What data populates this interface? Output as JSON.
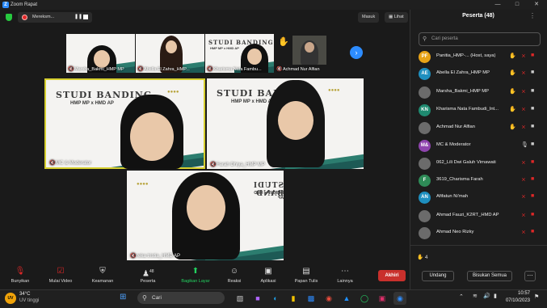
{
  "window": {
    "title": "Zoom Rapat",
    "logo": "Z"
  },
  "topbar": {
    "share_label": "Mereksm...",
    "view_btn": "Masuk",
    "view2_btn": "Lihat"
  },
  "thumbnails": [
    {
      "name": "Marsha_Bakmi_HMP MP"
    },
    {
      "name": "Abella El Zahra_HMP..."
    },
    {
      "name": "Kharisma Nata Fambu..."
    },
    {
      "name": "Achmad Nur Alfian"
    }
  ],
  "slide": {
    "title": "STUDI BANDING",
    "subtitle": "HMP MP x HMD AP",
    "title_small": "STUDI BANDING",
    "subtitle_small": "HMP MP x HMD AP",
    "mirror_title": "STUDI BAND",
    "mirror_sub": "HMP MP x HMD AP"
  },
  "tiles": [
    {
      "name": "MC & Moderator"
    },
    {
      "name": "Farah Dhiya_HMP MP"
    },
    {
      "name": "reka tristia_HMD AP"
    }
  ],
  "toolbar": {
    "items": [
      {
        "label": "Bunyikan",
        "icon": "mic-muted-icon"
      },
      {
        "label": "Mulai Video",
        "icon": "video-off-icon"
      },
      {
        "label": "Keamanan",
        "icon": "shield-icon"
      },
      {
        "label": "Peserta",
        "count": "48",
        "icon": "participants-icon"
      },
      {
        "label": "Bagikan Layar",
        "icon": "share-screen-icon"
      },
      {
        "label": "Reaksi",
        "icon": "reaction-icon"
      },
      {
        "label": "Aplikasi",
        "icon": "apps-icon"
      },
      {
        "label": "Papan Tulis",
        "icon": "whiteboard-icon"
      },
      {
        "label": "Lainnya",
        "icon": "more-icon"
      }
    ],
    "end_label": "Akhiri"
  },
  "panel": {
    "title": "Peserta (48)",
    "search_placeholder": "Cari peserta",
    "participants": [
      {
        "initials": "PF",
        "color": "#e8a317",
        "name": "Panitia_HMP-...",
        "note": "(Host, saya)"
      },
      {
        "initials": "AE",
        "color": "#1e8fbf",
        "name": "Abella El Zahra_HMP MP"
      },
      {
        "initials": "",
        "color": "#6b6b6b",
        "name": "Marsha_Bakmi_HMP MP"
      },
      {
        "initials": "KN",
        "color": "#1f8a70",
        "name": "Kharisma Nata Fambudi_Int..."
      },
      {
        "initials": "",
        "color": "#6b6b6b",
        "name": "Achmad Nur Alfian"
      },
      {
        "initials": "M&",
        "color": "#8e44ad",
        "name": "MC & Moderator"
      },
      {
        "initials": "",
        "color": "#6b6b6b",
        "name": "062_Lili Dwi Galuh Virnawati"
      },
      {
        "initials": "F",
        "color": "#2e8b57",
        "name": "3619_Charisma Farah"
      },
      {
        "initials": "AN",
        "color": "#1e8fbf",
        "name": "Afifatun Ni'mah"
      },
      {
        "initials": "",
        "color": "#6b6b6b",
        "name": "Ahmad Fauzi_K2RT_HMD AP"
      },
      {
        "initials": "",
        "color": "#6b6b6b",
        "name": "Ahmad Neo Rizky"
      }
    ],
    "hand_count": "4",
    "btn_invite": "Undang",
    "btn_mute_all": "Bisukan Semua"
  },
  "taskbar": {
    "weather_temp": "34°C",
    "weather_desc": "UV tinggi",
    "search_label": "Cari",
    "time": "10:57",
    "date": "07/10/2023"
  }
}
